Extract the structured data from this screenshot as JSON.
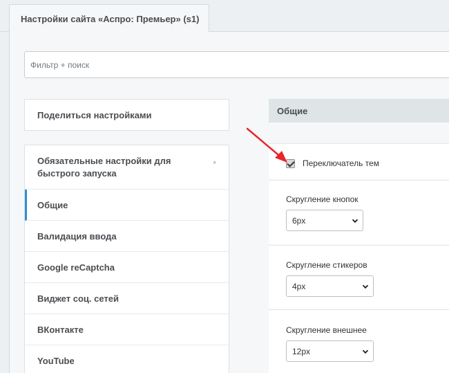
{
  "tab": {
    "title": "Настройки сайта «Аспро: Премьер» (s1)"
  },
  "filter": {
    "placeholder": "Фильтр + поиск"
  },
  "share": {
    "label": "Поделиться настройками"
  },
  "sidebar": {
    "items": [
      {
        "label": "Обязательные настройки для быстрого запуска",
        "star": "*"
      },
      {
        "label": "Общие",
        "active": true
      },
      {
        "label": "Валидация ввода"
      },
      {
        "label": "Google reCaptcha"
      },
      {
        "label": "Виджет соц. сетей"
      },
      {
        "label": "ВКонтакте"
      },
      {
        "label": "YouTube"
      }
    ]
  },
  "section": {
    "title": "Общие"
  },
  "settings": {
    "theme_switch": {
      "label": "Переключатель тем",
      "checked": true
    },
    "button_rounding": {
      "label": "Скругление кнопок",
      "value": "6px"
    },
    "sticker_rounding": {
      "label": "Скругление стикеров",
      "value": "4px"
    },
    "outer_rounding": {
      "label": "Скругление внешнее",
      "value": "12px"
    }
  },
  "colors": {
    "accent": "#2b8fd6",
    "annotation_arrow": "#e8262a"
  }
}
